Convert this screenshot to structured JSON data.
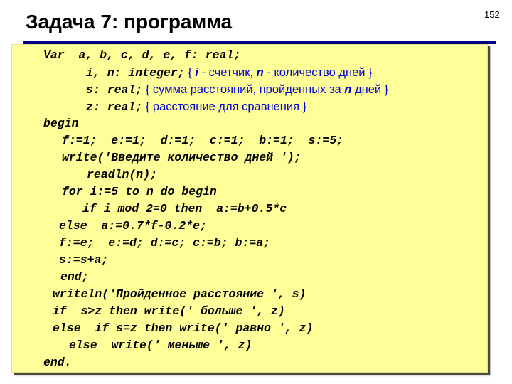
{
  "slide": {
    "title": "Задача 7: программа",
    "page_number": "152"
  },
  "colors": {
    "title_rule": "#000080",
    "code_background": "#ffff99",
    "code_text": "#000000",
    "comment_text": "#0000cc"
  },
  "code": {
    "lines": [
      {
        "code": "Var  a, b, c, d, e, f: real;"
      },
      {
        "code": "i, n: integer;",
        "comment": {
          "open": " { ",
          "parts": [
            {
              "text": "i",
              "hl": true
            },
            {
              "text": " - счетчик, "
            },
            {
              "text": "n",
              "hl": true
            },
            {
              "text": " - количество дней }"
            }
          ]
        }
      },
      {
        "code": "s: real;",
        "comment": {
          "open": " { ",
          "parts": [
            {
              "text": "сумма расстояний, пройденных за "
            },
            {
              "text": "n",
              "hl": true
            },
            {
              "text": " дней }"
            }
          ]
        }
      },
      {
        "code": "z: real;",
        "comment": {
          "open": " { ",
          "parts": [
            {
              "text": "расстояние для сравнения }"
            }
          ]
        }
      },
      {
        "code": "begin"
      },
      {
        "code": "f:=1;  e:=1;  d:=1;  c:=1;  b:=1;  s:=5;"
      },
      {
        "code": "write('Введите количество дней ');"
      },
      {
        "code": "readln(n);"
      },
      {
        "code": "for i:=5 to n do begin"
      },
      {
        "code": "if i mod 2=0 then  a:=b+0.5*c"
      },
      {
        "code": "else  a:=0.7*f-0.2*e;"
      },
      {
        "code": "f:=e;  e:=d; d:=c; c:=b; b:=a;"
      },
      {
        "code": "s:=s+a;"
      },
      {
        "code": "end;"
      },
      {
        "code": "writeln('Пройденное расстояние ', s)"
      },
      {
        "code": "if  s>z then write(' больше ', z)"
      },
      {
        "code": "else  if s=z then write(' равно ', z)"
      },
      {
        "code": "else  write(' меньше ', z)"
      },
      {
        "code": "end."
      }
    ]
  }
}
